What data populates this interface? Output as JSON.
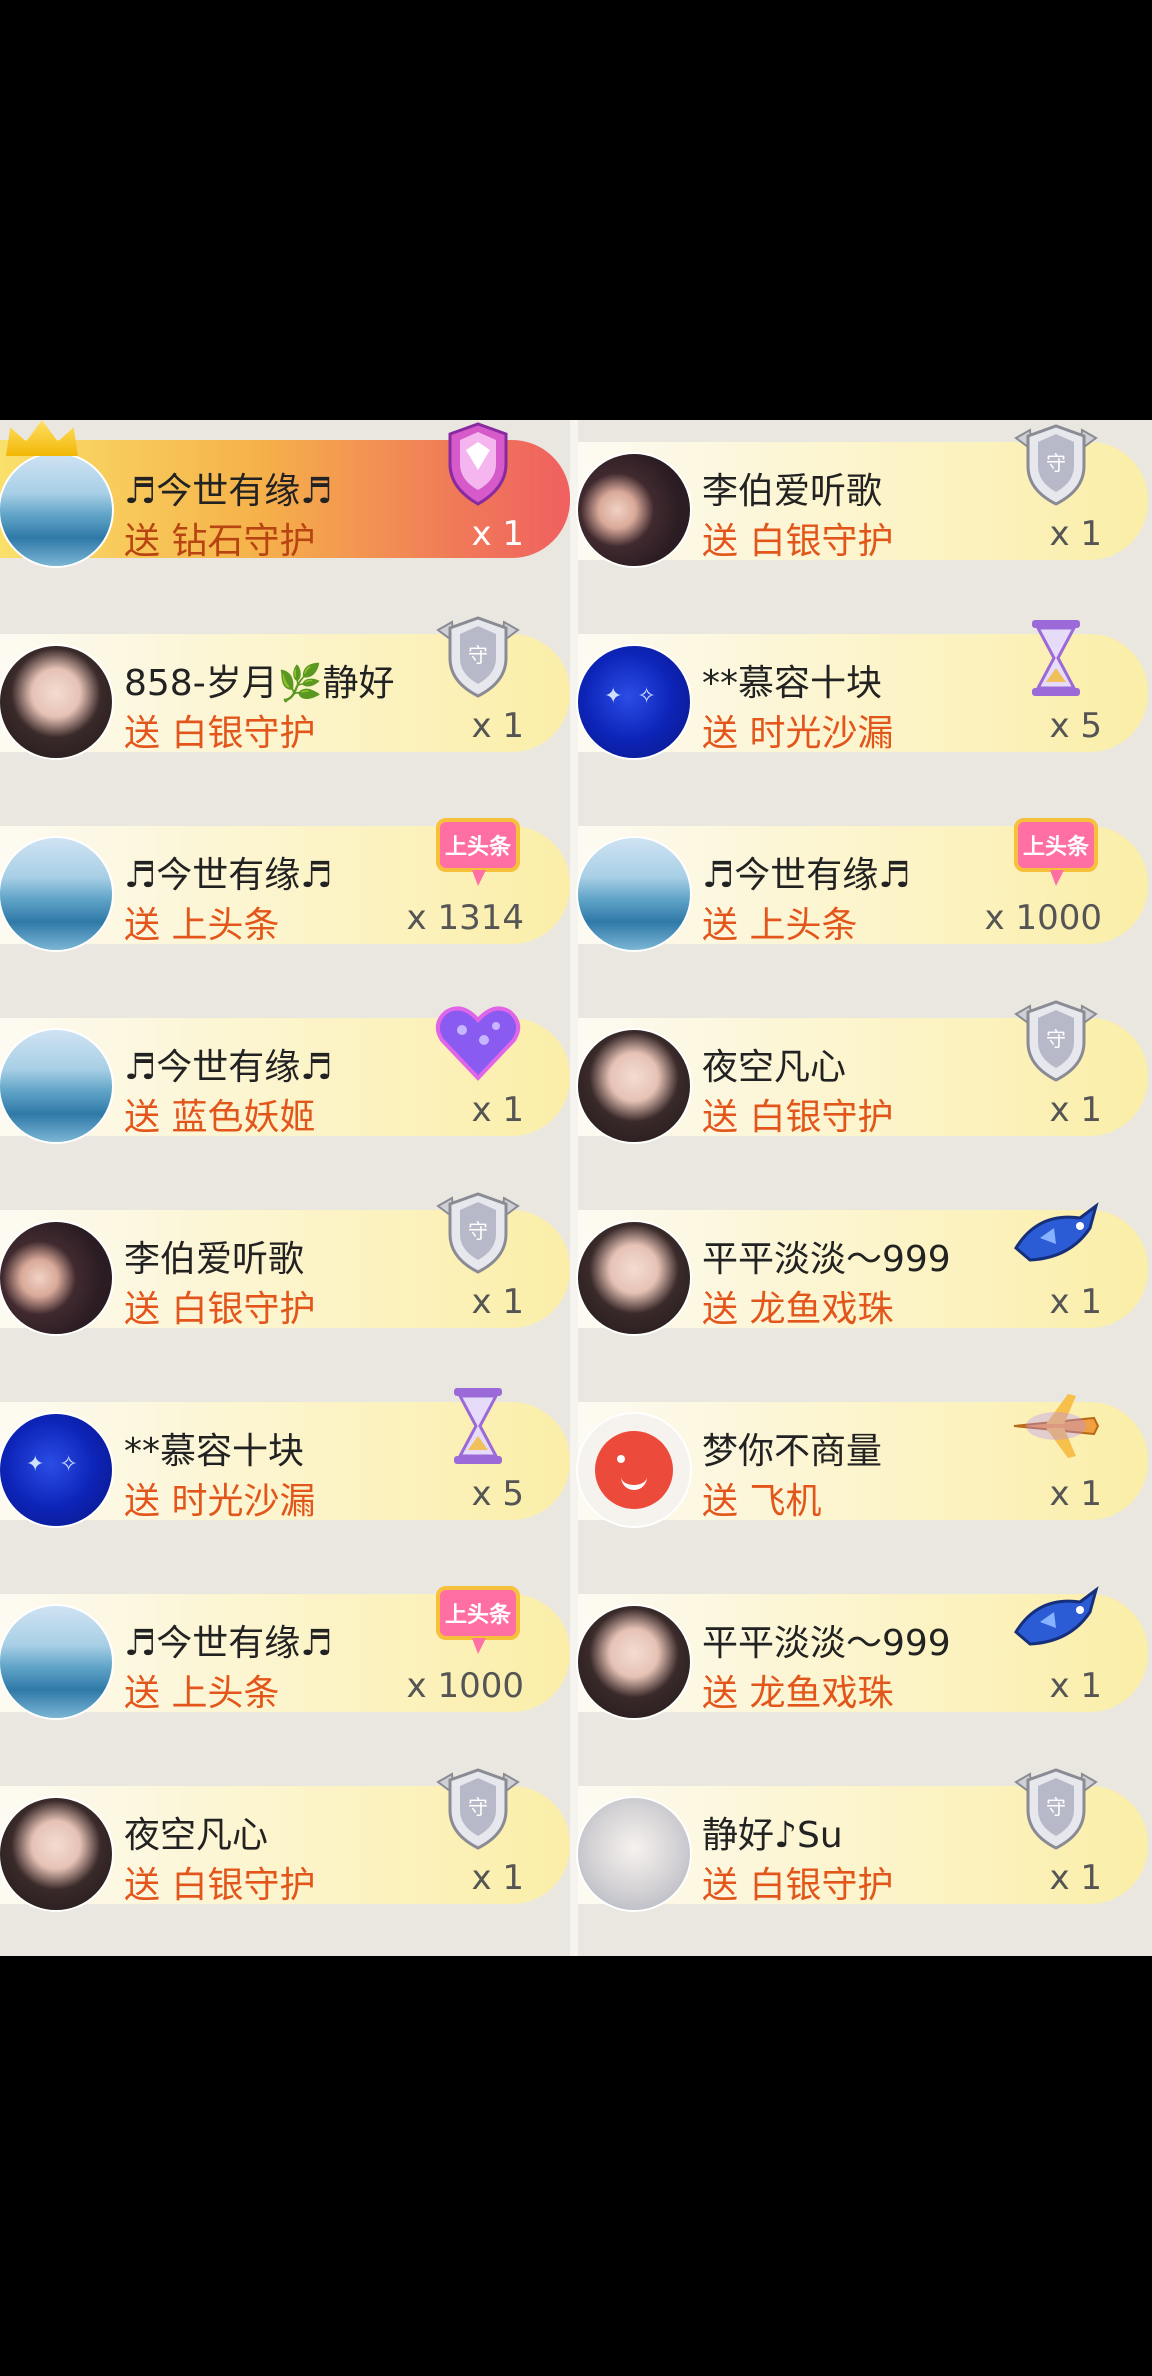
{
  "left": [
    {
      "avatar": "ocean",
      "name": "♬今世有缘♬",
      "action": "送 钻石守护",
      "count": "x 1",
      "gift_icon": "diamond-guard-icon",
      "highlight": true
    },
    {
      "avatar": "portrait",
      "name": "858-岁月🌿静好",
      "action": "送 白银守护",
      "count": "x 1",
      "gift_icon": "silver-guard-icon"
    },
    {
      "avatar": "ocean",
      "name": "♬今世有缘♬",
      "action": "送 上头条",
      "count": "x 1314",
      "gift_icon": "headline-icon",
      "gift_text": "上头条"
    },
    {
      "avatar": "ocean",
      "name": "♬今世有缘♬",
      "action": "送 蓝色妖姬",
      "count": "x 1",
      "gift_icon": "blue-heart-icon"
    },
    {
      "avatar": "duo",
      "name": "李伯爱听歌",
      "action": "送 白银守护",
      "count": "x 1",
      "gift_icon": "silver-guard-icon"
    },
    {
      "avatar": "blue",
      "name": "**慕容十块",
      "action": "送 时光沙漏",
      "count": "x 5",
      "gift_icon": "hourglass-icon"
    },
    {
      "avatar": "ocean",
      "name": "♬今世有缘♬",
      "action": "送 上头条",
      "count": "x 1000",
      "gift_icon": "headline-icon",
      "gift_text": "上头条"
    },
    {
      "avatar": "portrait",
      "name": "夜空凡心",
      "action": "送 白银守护",
      "count": "x 1",
      "gift_icon": "silver-guard-icon"
    }
  ],
  "right": [
    {
      "avatar": "duo",
      "name": "李伯爱听歌",
      "action": "送 白银守护",
      "count": "x 1",
      "gift_icon": "silver-guard-icon"
    },
    {
      "avatar": "blue",
      "name": "**慕容十块",
      "action": "送 时光沙漏",
      "count": "x 5",
      "gift_icon": "hourglass-icon"
    },
    {
      "avatar": "ocean",
      "name": "♬今世有缘♬",
      "action": "送 上头条",
      "count": "x 1000",
      "gift_icon": "headline-icon",
      "gift_text": "上头条"
    },
    {
      "avatar": "portrait",
      "name": "夜空凡心",
      "action": "送 白银守护",
      "count": "x 1",
      "gift_icon": "silver-guard-icon"
    },
    {
      "avatar": "portrait",
      "name": "平平淡淡～999",
      "action": "送 龙鱼戏珠",
      "count": "x 1",
      "gift_icon": "dragon-fish-icon"
    },
    {
      "avatar": "red",
      "name": "梦你不商量",
      "action": "送 飞机",
      "count": "x 1",
      "gift_icon": "airplane-icon"
    },
    {
      "avatar": "portrait",
      "name": "平平淡淡～999",
      "action": "送 龙鱼戏珠",
      "count": "x 1",
      "gift_icon": "dragon-fish-icon"
    },
    {
      "avatar": "light",
      "name": "静好♪Su",
      "action": "送 白银守护",
      "count": "x 1",
      "gift_icon": "silver-guard-icon"
    }
  ]
}
